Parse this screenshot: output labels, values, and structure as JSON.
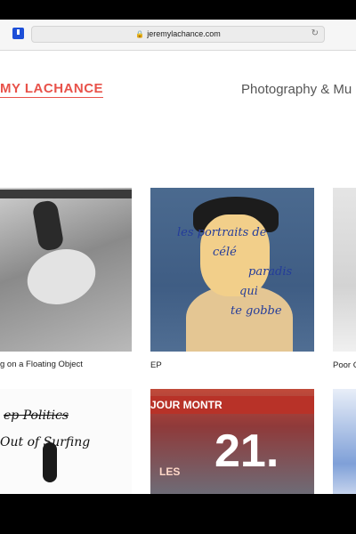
{
  "browser": {
    "url": "jeremylachance.com"
  },
  "header": {
    "brand": "MY LACHANCE",
    "tagline": "Photography & Mu"
  },
  "grid": {
    "items": [
      {
        "caption": "g on a Floating Object"
      },
      {
        "caption": "EP",
        "scribble": [
          "les portraits de",
          "célé",
          "paradis",
          "qui",
          "te gobbe"
        ]
      },
      {
        "caption": "Poor C"
      },
      {
        "text_lines": [
          "ep Politics",
          "Out of Surfing"
        ]
      },
      {
        "sign": "JOUR        MONTR",
        "number": "21.",
        "small": "LES"
      },
      {}
    ]
  },
  "colors": {
    "accent": "#e8524a",
    "tagline": "#555555"
  }
}
